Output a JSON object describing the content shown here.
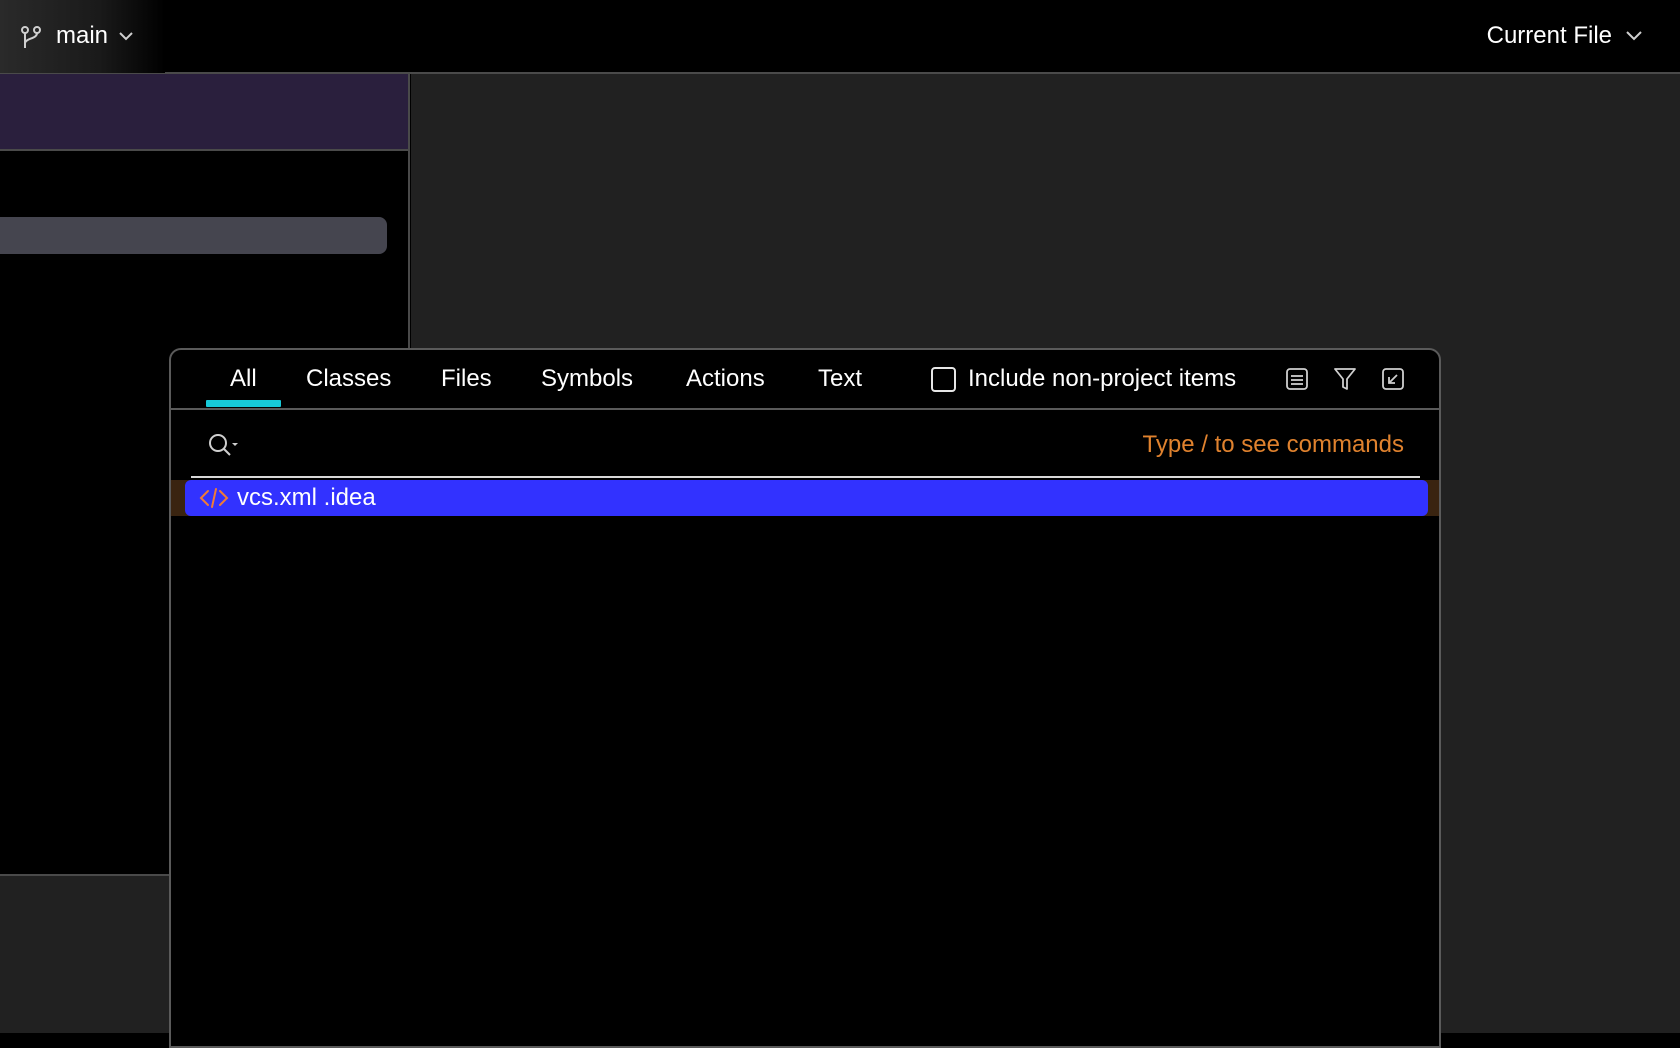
{
  "titlebar": {
    "branch": {
      "name": "main",
      "icon": "git-branch-icon"
    },
    "run_config": {
      "label": "Current File"
    }
  },
  "search_popup": {
    "tabs": [
      {
        "label": "All",
        "selected": true
      },
      {
        "label": "Classes",
        "selected": false
      },
      {
        "label": "Files",
        "selected": false
      },
      {
        "label": "Symbols",
        "selected": false
      },
      {
        "label": "Actions",
        "selected": false
      },
      {
        "label": "Text",
        "selected": false
      }
    ],
    "include_non_project": {
      "label": "Include non-project items",
      "checked": false
    },
    "toolbar_icons": [
      "preview-icon",
      "filter-icon",
      "collapse-icon"
    ],
    "search": {
      "value": "",
      "hint": "Type / to see commands"
    },
    "results": [
      {
        "label": "vcs.xml .idea",
        "icon": "xml-file-icon",
        "selected": true
      }
    ]
  },
  "colors": {
    "accent_tab_underline": "#17c9d8",
    "selection": "#3232ff",
    "hint": "#e0822e",
    "left_header": "#2a1f3d"
  }
}
